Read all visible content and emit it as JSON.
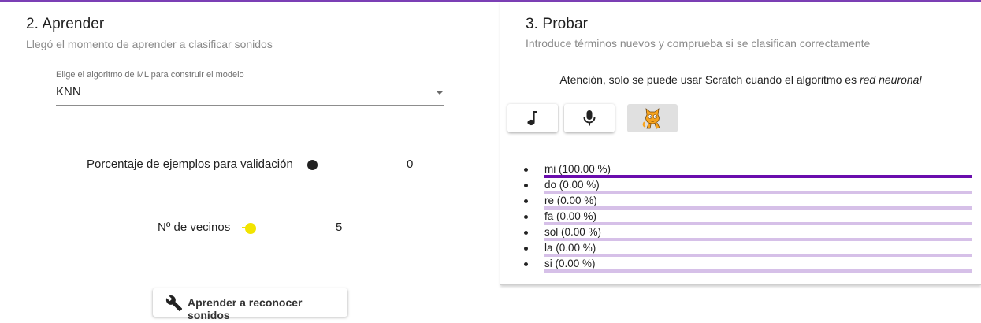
{
  "colors": {
    "accent_purple": "#7b3fb5",
    "bar_active": "#6a0dad",
    "bar_inactive": "#d6c0e8",
    "slider_dark": "#212121",
    "slider_yellow": "#f2e400"
  },
  "learn": {
    "title": "2. Aprender",
    "subtitle": "Llegó el momento de aprender a clasificar sonidos",
    "algorithm_select": {
      "label": "Elige el algoritmo de ML para construir el modelo",
      "value": "KNN"
    },
    "validation_slider": {
      "label": "Porcentaje de ejemplos para validación",
      "value": "0",
      "fraction": 0
    },
    "neighbors_slider": {
      "label": "Nº de vecinos",
      "value": "5",
      "fraction": 0.1
    },
    "train_button": {
      "label": "Aprender a reconocer sonidos",
      "icon": "wrench-icon"
    }
  },
  "test": {
    "title": "3. Probar",
    "subtitle": "Introduce términos nuevos y comprueba si se clasifican correctamente",
    "notice_prefix": "Atención, solo se puede usar Scratch cuando el algoritmo es ",
    "notice_emph": "red neuronal",
    "mode_buttons": [
      {
        "icon": "music-note-icon"
      },
      {
        "icon": "microphone-icon"
      },
      {
        "icon": "scratch-cat-icon",
        "disabled": true
      }
    ],
    "results": [
      {
        "label": "mi (100.00 %)",
        "value": 100
      },
      {
        "label": "do (0.00 %)",
        "value": 0
      },
      {
        "label": "re (0.00 %)",
        "value": 0
      },
      {
        "label": "fa (0.00 %)",
        "value": 0
      },
      {
        "label": "sol (0.00 %)",
        "value": 0
      },
      {
        "label": "la (0.00 %)",
        "value": 0
      },
      {
        "label": "si (0.00 %)",
        "value": 0
      }
    ]
  }
}
